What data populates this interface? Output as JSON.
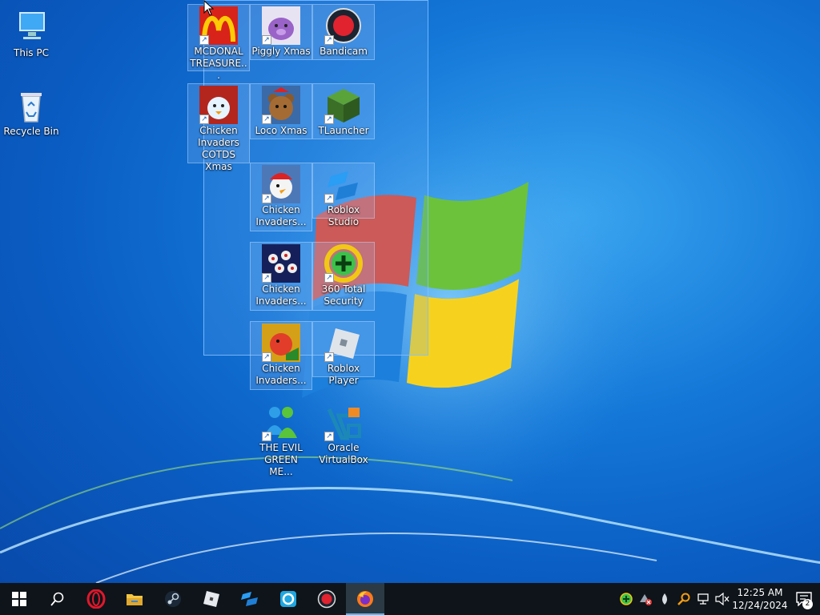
{
  "desktop": {
    "icons": [
      {
        "label": "This PC",
        "icon": "computer-icon"
      },
      {
        "label": "Recycle Bin",
        "icon": "recycle-bin-icon"
      },
      {
        "label": "MCDONAL TREASURE...",
        "icon": "mcdonalds-icon"
      },
      {
        "label": "Piggly Xmas",
        "icon": "piggly-icon"
      },
      {
        "label": "Bandicam",
        "icon": "bandicam-icon"
      },
      {
        "label": "Chicken Invaders COTDS Xmas",
        "icon": "chicken-snowman-icon"
      },
      {
        "label": "Loco Xmas",
        "icon": "teddy-bear-icon"
      },
      {
        "label": "TLauncher",
        "icon": "grass-block-icon"
      },
      {
        "label": "Chicken Invaders...",
        "icon": "chicken-santa-icon"
      },
      {
        "label": "Roblox Studio",
        "icon": "roblox-studio-icon"
      },
      {
        "label": "Chicken Invaders...",
        "icon": "eggs-icon"
      },
      {
        "label": "360 Total Security",
        "icon": "360-security-icon"
      },
      {
        "label": "Chicken Invaders...",
        "icon": "chicken-invaders-icon"
      },
      {
        "label": "Roblox Player",
        "icon": "roblox-player-icon"
      },
      {
        "label": "THE EVIL GREEN ME...",
        "icon": "messenger-people-icon"
      },
      {
        "label": "Oracle VirtualBox",
        "icon": "virtualbox-icon"
      }
    ]
  },
  "taskbar": {
    "apps": [
      "start-icon",
      "search-icon",
      "opera-icon",
      "file-explorer-icon",
      "steam-icon",
      "roblox-icon",
      "roblox-studio-icon",
      "ccleaner-icon",
      "bandicam-icon",
      "firefox-icon"
    ],
    "tray": [
      "360-security-tray-icon",
      "network-error-tray-icon",
      "water-drop-tray-icon",
      "search-tray-icon",
      "network-tray-icon",
      "speaker-muted-icon"
    ],
    "time": "12:25 AM",
    "date": "12/24/2024",
    "notification_count": "2"
  },
  "colors": {
    "desktop_bg": "#0a5cc2",
    "taskbar_bg": "#0e1419",
    "accent": "#58b8f8"
  }
}
